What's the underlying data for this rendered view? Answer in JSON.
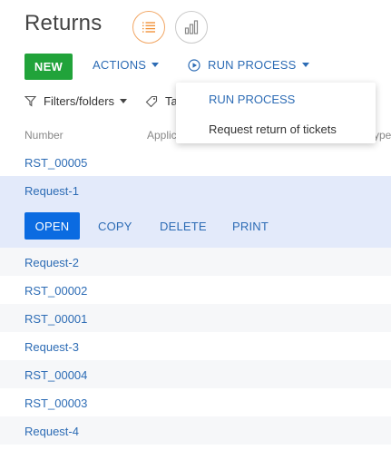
{
  "header": {
    "title": "Returns",
    "views": [
      {
        "icon": "list-view-icon",
        "active": true
      },
      {
        "icon": "chart-view-icon",
        "active": false
      }
    ]
  },
  "toolbar": {
    "new_label": "NEW",
    "actions_label": "ACTIONS",
    "run_process_label": "RUN PROCESS",
    "new_color": "#21a33a",
    "accent_color": "#2d6cb5"
  },
  "run_process_menu": {
    "items": [
      "RUN PROCESS",
      "Request return of tickets"
    ]
  },
  "filters": {
    "filters_label": "Filters/folders",
    "tags_label": "Ta"
  },
  "columns": [
    "Number",
    "Applic",
    "ype"
  ],
  "rows": [
    {
      "label": "RST_00005"
    },
    {
      "label": "Request-1",
      "selected": true
    },
    {
      "label": "Request-2"
    },
    {
      "label": "RST_00002"
    },
    {
      "label": "RST_00001"
    },
    {
      "label": "Request-3"
    },
    {
      "label": "RST_00004"
    },
    {
      "label": "RST_00003"
    },
    {
      "label": "Request-4"
    }
  ],
  "row_actions": {
    "open": "OPEN",
    "copy": "COPY",
    "delete": "DELETE",
    "print": "PRINT",
    "open_color": "#0b6be1"
  }
}
